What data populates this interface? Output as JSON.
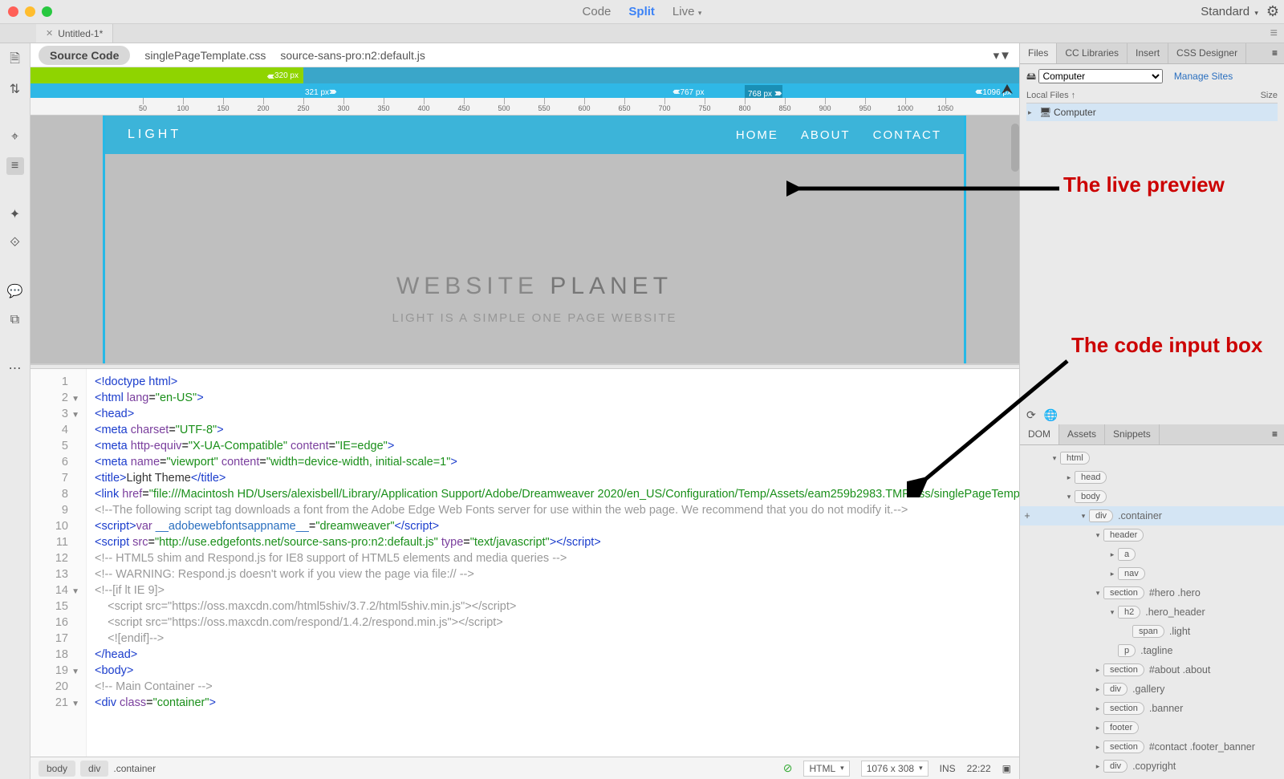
{
  "titlebar": {
    "view_modes": [
      "Code",
      "Split",
      "Live"
    ],
    "active_mode": "Split",
    "workspace": "Standard"
  },
  "doc_tab": {
    "name": "Untitled-1*"
  },
  "related_files": {
    "source": "Source Code",
    "files": [
      "singlePageTemplate.css",
      "source-sans-pro:n2:default.js"
    ]
  },
  "breakpoints": {
    "green_px": "320  px",
    "mid_left": "321  px",
    "mid_right": "767  px",
    "blue_left": "768  px",
    "blue_right": "1096  px"
  },
  "ruler_ticks": [
    50,
    100,
    150,
    200,
    250,
    300,
    350,
    400,
    450,
    500,
    550,
    600,
    650,
    700,
    750,
    800,
    850,
    900,
    950,
    1000,
    1050
  ],
  "preview": {
    "logo": "LIGHT",
    "nav": [
      "HOME",
      "ABOUT",
      "CONTACT"
    ],
    "hero_word1": "WEBSITE",
    "hero_word2": "PLANET",
    "tagline": "LIGHT IS A SIMPLE ONE PAGE WEBSITE"
  },
  "annotations": {
    "preview": "The live preview",
    "code": "The code input box"
  },
  "code_lines": [
    {
      "n": 1,
      "f": "",
      "html": "<span class='c-tag'>&lt;!doctype html&gt;</span>"
    },
    {
      "n": 2,
      "f": "▼",
      "html": "<span class='c-tag'>&lt;html</span> <span class='c-attr'>lang</span>=<span class='c-str'>\"en-US\"</span><span class='c-tag'>&gt;</span>"
    },
    {
      "n": 3,
      "f": "▼",
      "html": "<span class='c-tag'>&lt;head&gt;</span>"
    },
    {
      "n": 4,
      "f": "",
      "html": "<span class='c-tag'>&lt;meta</span> <span class='c-attr'>charset</span>=<span class='c-str'>\"UTF-8\"</span><span class='c-tag'>&gt;</span>"
    },
    {
      "n": 5,
      "f": "",
      "html": "<span class='c-tag'>&lt;meta</span> <span class='c-attr'>http-equiv</span>=<span class='c-str'>\"X-UA-Compatible\"</span> <span class='c-attr'>content</span>=<span class='c-str'>\"IE=edge\"</span><span class='c-tag'>&gt;</span>"
    },
    {
      "n": 6,
      "f": "",
      "html": "<span class='c-tag'>&lt;meta</span> <span class='c-attr'>name</span>=<span class='c-str'>\"viewport\"</span> <span class='c-attr'>content</span>=<span class='c-str'>\"width=device-width, initial-scale=1\"</span><span class='c-tag'>&gt;</span>"
    },
    {
      "n": 7,
      "f": "",
      "html": "<span class='c-tag'>&lt;title&gt;</span><span class='c-plain'>Light Theme</span><span class='c-tag'>&lt;/title&gt;</span>"
    },
    {
      "n": 8,
      "f": "",
      "html": "<span class='c-tag'>&lt;link</span> <span class='c-attr'>href</span>=<span class='c-str'>\"file:///Macintosh HD/Users/alexisbell/Library/Application Support/Adobe/Dreamweaver 2020/en_US/Configuration/Temp/Assets/eam259b2983.TMP/css/singlePageTemplate.css\"</span> <span class='c-attr'>rel</span>=<span class='c-str'>\"stylesheet\"</span> <span class='c-attr'>type</span>=<span class='c-str'>\"text/css\"</span><span class='c-tag'>&gt;</span>"
    },
    {
      "n": 9,
      "f": "",
      "html": "<span class='c-com'>&lt;!--The following script tag downloads a font from the Adobe Edge Web Fonts server for use within the web page. We recommend that you do not modify it.--&gt;</span>"
    },
    {
      "n": 10,
      "f": "",
      "html": "<span class='c-tag'>&lt;script&gt;</span><span class='c-attr'>var</span> <span class='c-var'>__adobewebfontsappname__</span>=<span class='c-str'>\"dreamweaver\"</span><span class='c-tag'>&lt;/script&gt;</span>"
    },
    {
      "n": 11,
      "f": "",
      "html": "<span class='c-tag'>&lt;script</span> <span class='c-attr'>src</span>=<span class='c-str'>\"http://use.edgefonts.net/source-sans-pro:n2:default.js\"</span> <span class='c-attr'>type</span>=<span class='c-str'>\"text/javascript\"</span><span class='c-tag'>&gt;&lt;/script&gt;</span>"
    },
    {
      "n": 12,
      "f": "",
      "html": "<span class='c-com'>&lt;!-- HTML5 shim and Respond.js for IE8 support of HTML5 elements and media queries --&gt;</span>"
    },
    {
      "n": 13,
      "f": "",
      "html": "<span class='c-com'>&lt;!-- WARNING: Respond.js doesn't work if you view the page via file:// --&gt;</span>"
    },
    {
      "n": 14,
      "f": "▼",
      "html": "<span class='c-com'>&lt;!--[if lt IE 9]&gt;</span>"
    },
    {
      "n": 15,
      "f": "",
      "html": "<span class='c-com'>    &lt;script src=\"https://oss.maxcdn.com/html5shiv/3.7.2/html5shiv.min.js\"&gt;&lt;/script&gt;</span>"
    },
    {
      "n": 16,
      "f": "",
      "html": "<span class='c-com'>    &lt;script src=\"https://oss.maxcdn.com/respond/1.4.2/respond.min.js\"&gt;&lt;/script&gt;</span>"
    },
    {
      "n": 17,
      "f": "",
      "html": "<span class='c-com'>    &lt;![endif]--&gt;</span>"
    },
    {
      "n": 18,
      "f": "",
      "html": "<span class='c-tag'>&lt;/head&gt;</span>"
    },
    {
      "n": 19,
      "f": "▼",
      "html": "<span class='c-tag'>&lt;body&gt;</span>"
    },
    {
      "n": 20,
      "f": "",
      "html": "<span class='c-com'>&lt;!-- Main Container --&gt;</span>"
    },
    {
      "n": 21,
      "f": "▼",
      "html": "<span class='c-tag'>&lt;div</span> <span class='c-attr'>class</span>=<span class='c-str'>\"container\"</span><span class='c-tag'>&gt;</span>"
    }
  ],
  "statusbar": {
    "crumbs": [
      "body",
      "div",
      ".container"
    ],
    "lang": "HTML",
    "size": "1076 x 308",
    "mode": "INS",
    "pos": "22:22"
  },
  "panels": {
    "top_tabs": [
      "Files",
      "CC Libraries",
      "Insert",
      "CSS Designer"
    ],
    "top_active": "Files",
    "files": {
      "select": "Computer",
      "manage": "Manage Sites",
      "col1": "Local Files ↑",
      "col2": "Size",
      "row": "Computer"
    },
    "dom_tabs": [
      "DOM",
      "Assets",
      "Snippets"
    ],
    "dom_active": "DOM",
    "dom_tree": [
      {
        "indent": 0,
        "tri": "▾",
        "tag": "html",
        "extra": "",
        "sel": false
      },
      {
        "indent": 1,
        "tri": "▸",
        "tag": "head",
        "extra": "",
        "sel": false
      },
      {
        "indent": 1,
        "tri": "▾",
        "tag": "body",
        "extra": "",
        "sel": false
      },
      {
        "indent": 2,
        "tri": "▾",
        "tag": "div",
        "extra": ".container",
        "sel": true,
        "plus": true
      },
      {
        "indent": 3,
        "tri": "▾",
        "tag": "header",
        "extra": "",
        "sel": false
      },
      {
        "indent": 4,
        "tri": "▸",
        "tag": "a",
        "extra": "",
        "sel": false
      },
      {
        "indent": 4,
        "tri": "▸",
        "tag": "nav",
        "extra": "",
        "sel": false
      },
      {
        "indent": 3,
        "tri": "▾",
        "tag": "section",
        "extra": "#hero .hero",
        "sel": false
      },
      {
        "indent": 4,
        "tri": "▾",
        "tag": "h2",
        "extra": ".hero_header",
        "sel": false
      },
      {
        "indent": 5,
        "tri": "",
        "tag": "span",
        "extra": ".light",
        "sel": false
      },
      {
        "indent": 4,
        "tri": "",
        "tag": "p",
        "extra": ".tagline",
        "sel": false
      },
      {
        "indent": 3,
        "tri": "▸",
        "tag": "section",
        "extra": "#about .about",
        "sel": false
      },
      {
        "indent": 3,
        "tri": "▸",
        "tag": "div",
        "extra": ".gallery",
        "sel": false
      },
      {
        "indent": 3,
        "tri": "▸",
        "tag": "section",
        "extra": ".banner",
        "sel": false
      },
      {
        "indent": 3,
        "tri": "▸",
        "tag": "footer",
        "extra": "",
        "sel": false
      },
      {
        "indent": 3,
        "tri": "▸",
        "tag": "section",
        "extra": "#contact .footer_banner",
        "sel": false
      },
      {
        "indent": 3,
        "tri": "▸",
        "tag": "div",
        "extra": ".copyright",
        "sel": false
      }
    ]
  }
}
